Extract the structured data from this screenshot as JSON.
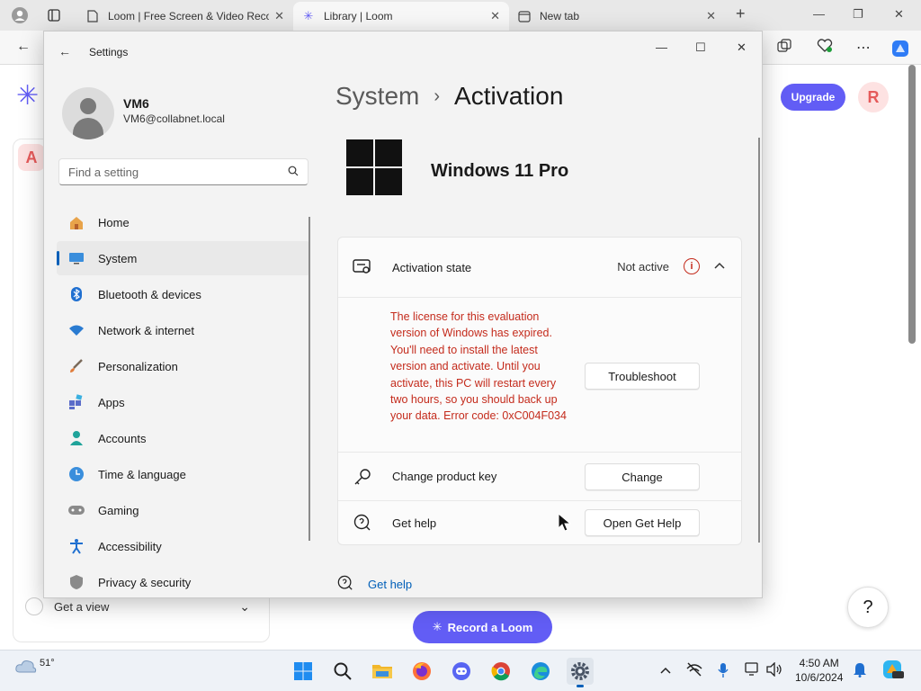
{
  "browser": {
    "tabs": [
      {
        "title": "Loom | Free Screen & Video Reco",
        "icon": "document-icon"
      },
      {
        "title": "Library | Loom",
        "icon": "loom-icon"
      },
      {
        "title": "New tab",
        "icon": "newtab-icon"
      }
    ]
  },
  "loom": {
    "upgrade_label": "Upgrade",
    "avatar_letter": "R",
    "workspace_letter": "A",
    "get_view_label": "Get a view",
    "record_label": "Record a Loom",
    "help_label": "?"
  },
  "settings": {
    "window_title": "Settings",
    "profile": {
      "name": "VM6",
      "email": "VM6@collabnet.local"
    },
    "search_placeholder": "Find a setting",
    "nav": [
      {
        "label": "Home",
        "icon": "home-icon"
      },
      {
        "label": "System",
        "icon": "system-icon"
      },
      {
        "label": "Bluetooth & devices",
        "icon": "bluetooth-icon"
      },
      {
        "label": "Network & internet",
        "icon": "wifi-icon"
      },
      {
        "label": "Personalization",
        "icon": "brush-icon"
      },
      {
        "label": "Apps",
        "icon": "apps-icon"
      },
      {
        "label": "Accounts",
        "icon": "person-icon"
      },
      {
        "label": "Time & language",
        "icon": "globe-clock-icon"
      },
      {
        "label": "Gaming",
        "icon": "gamepad-icon"
      },
      {
        "label": "Accessibility",
        "icon": "accessibility-icon"
      },
      {
        "label": "Privacy & security",
        "icon": "shield-icon"
      }
    ],
    "breadcrumb": {
      "parent": "System",
      "separator": "›",
      "current": "Activation"
    },
    "edition": "Windows 11 Pro",
    "activation_state": {
      "label": "Activation state",
      "status": "Not active",
      "message": "The license for this evaluation version of Windows has expired. You'll need to install the latest version and activate. Until you activate, this PC will restart every two hours, so you should back up your data. Error code: 0xC004F034",
      "button": "Troubleshoot"
    },
    "product_key": {
      "label": "Change product key",
      "button": "Change"
    },
    "get_help_row": {
      "label": "Get help",
      "button": "Open Get Help"
    },
    "footer_link": "Get help"
  },
  "taskbar": {
    "weather": "51°",
    "time": "4:50 AM",
    "date": "10/6/2024"
  },
  "colors": {
    "accent": "#005fb8",
    "error": "#c42b1c",
    "loom_purple": "#625df5"
  }
}
